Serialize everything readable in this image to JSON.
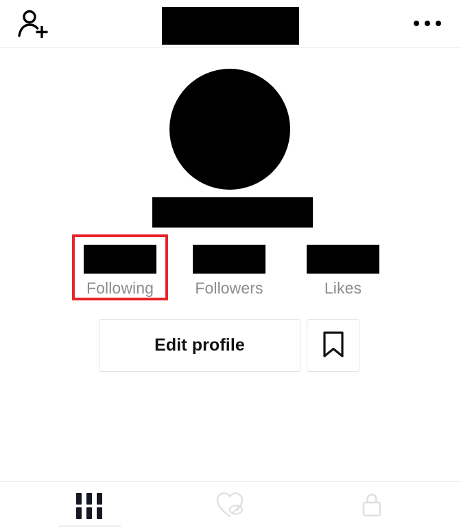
{
  "app": {
    "name": "TikTok Profile",
    "background_color": "#ffffff"
  },
  "header": {
    "add_friend_icon": "person-add-icon",
    "title": "",
    "title_redacted": true,
    "more_icon": "more-horizontal-icon"
  },
  "profile": {
    "avatar_alt": "profile-avatar",
    "avatar_redacted": true,
    "username": "",
    "username_redacted": true
  },
  "stats": [
    {
      "value": "",
      "label": "Following",
      "redacted": true,
      "highlighted": true
    },
    {
      "value": "",
      "label": "Followers",
      "redacted": true,
      "highlighted": false
    },
    {
      "value": "",
      "label": "Likes",
      "redacted": true,
      "highlighted": false
    }
  ],
  "highlight": {
    "color": "#e8242a",
    "target": "Following"
  },
  "actions": {
    "edit_profile_label": "Edit profile",
    "bookmark_icon": "bookmark-icon"
  },
  "tabbar": {
    "tabs": [
      {
        "icon": "grid-icon",
        "label": "",
        "active": true
      },
      {
        "icon": "heart-eye-slash-icon",
        "label": "",
        "active": false
      },
      {
        "icon": "lock-icon",
        "label": "",
        "active": false
      }
    ]
  },
  "colors": {
    "text_primary": "#121212",
    "text_secondary": "#8c8c8c",
    "border": "#e4e4e4",
    "divider": "#ededed",
    "accent_highlight": "#e8242a",
    "icon_active": "#161823",
    "icon_inactive": "#e0e0e0"
  }
}
